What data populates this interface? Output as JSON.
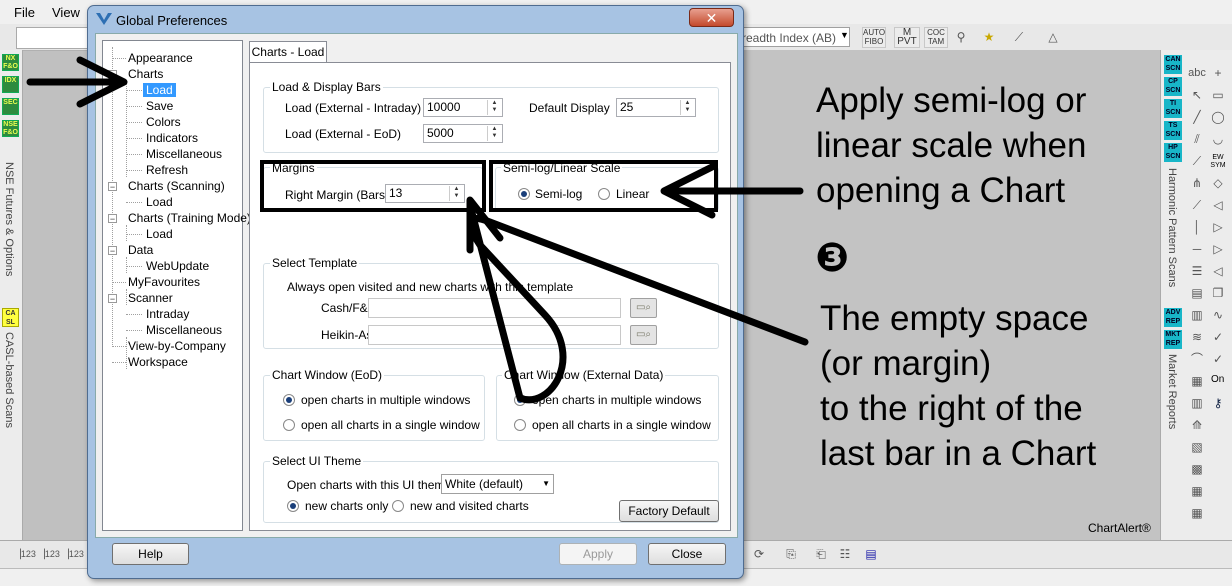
{
  "app": {
    "menu": [
      {
        "label": "File"
      },
      {
        "label": "View"
      }
    ],
    "breadth_combo": "readth Index (AB)",
    "left_tags": [
      "NX F&O",
      "IDX",
      "SEC",
      "NSE F&O"
    ],
    "left_vertical_1": "NSE Futures & Options",
    "left_yellow_tag": "CA SL",
    "left_vertical_2": "CASL-based Scans",
    "right_tags_top": [
      "CAN SCN",
      "CP SCN",
      "TI SCN",
      "TS SCN",
      "HP SCN"
    ],
    "right_vertical_1": "Harmonic Pattern Scans",
    "right_tags_bottom": [
      "ADV REP",
      "MKT REP"
    ],
    "right_vertical_2": "Market Reports",
    "tool_labels": [
      "abc",
      "EW SYM",
      "On"
    ],
    "toolbar_labels": [
      "AUTO FIBO",
      "M PVT",
      "COC TAM"
    ],
    "brand": "ChartAlert®"
  },
  "dialog": {
    "title": "Global Preferences",
    "close_label": "✕",
    "tree": [
      {
        "label": "Appearance"
      },
      {
        "label": "Charts"
      },
      {
        "label": "Load"
      },
      {
        "label": "Save"
      },
      {
        "label": "Colors"
      },
      {
        "label": "Indicators"
      },
      {
        "label": "Miscellaneous"
      },
      {
        "label": "Refresh"
      },
      {
        "label": "Charts (Scanning)"
      },
      {
        "label": "Load"
      },
      {
        "label": "Charts (Training Mode)"
      },
      {
        "label": "Load"
      },
      {
        "label": "Data"
      },
      {
        "label": "WebUpdate"
      },
      {
        "label": "MyFavourites"
      },
      {
        "label": "Scanner"
      },
      {
        "label": "Intraday"
      },
      {
        "label": "Miscellaneous"
      },
      {
        "label": "View-by-Company"
      },
      {
        "label": "Workspace"
      }
    ],
    "tab_label": "Charts - Load",
    "load_display": {
      "title": "Load & Display Bars",
      "intraday_label": "Load (External - Intraday)",
      "intraday_value": "10000",
      "eod_label": "Load (External - EoD)",
      "eod_value": "5000",
      "default_label": "Default Display",
      "default_value": "25"
    },
    "margins": {
      "title": "Margins",
      "right_label": "Right Margin (Bars)",
      "right_value": "13"
    },
    "scale": {
      "title": "Semi-log/Linear Scale",
      "semilog": "Semi-log",
      "linear": "Linear",
      "selected": "semilog"
    },
    "template": {
      "title": "Select Template",
      "desc": "Always open visited and new charts with this template",
      "cash_label": "Cash/F&O",
      "cash_value": "",
      "heikin_label": "Heikin-Ashi",
      "heikin_value": ""
    },
    "chart_window_eod": {
      "title": "Chart Window (EoD)",
      "opt1": "open charts in multiple windows",
      "opt2": "open all charts in a single window"
    },
    "chart_window_ext": {
      "title": "Chart Window (External Data)",
      "opt1": "open charts in multiple windows",
      "opt2": "open all charts in a single window"
    },
    "ui_theme": {
      "title": "Select UI Theme",
      "label": "Open charts with this UI theme",
      "value": "White (default)",
      "opt1": "new charts only",
      "opt2": "new and visited charts"
    },
    "buttons": {
      "factory": "Factory Default",
      "help": "Help",
      "apply": "Apply",
      "close": "Close"
    }
  },
  "annotations": {
    "a1": [
      "Apply semi-log or",
      "linear scale when",
      "opening a Chart"
    ],
    "number": "❸",
    "a2": [
      "The empty space",
      "(or margin)",
      "to the right of the",
      "last bar in a Chart"
    ]
  }
}
